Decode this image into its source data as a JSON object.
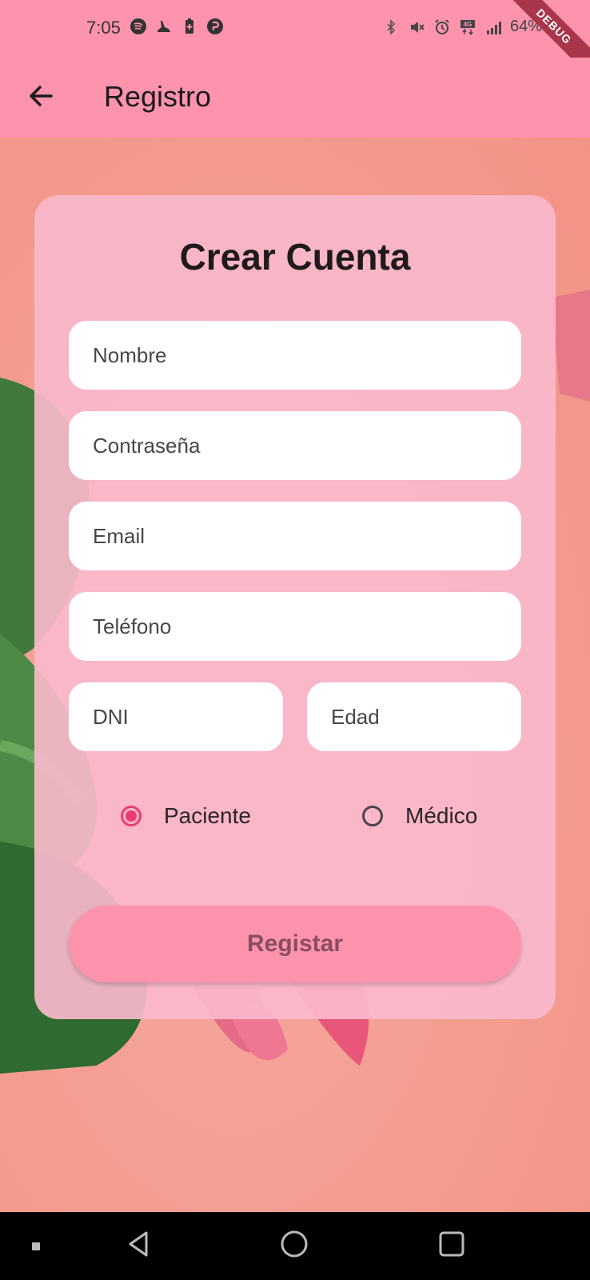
{
  "status_bar": {
    "time": "7:05",
    "battery": "64%",
    "debug_label": "DEBUG",
    "left_icons": [
      "spotify-icon",
      "shoe-icon",
      "battery-plus-icon",
      "p-app-icon"
    ],
    "right_icons": [
      "bluetooth-icon",
      "mute-icon",
      "alarm-icon",
      "4g-icon",
      "signal-icon",
      "battery-icon"
    ]
  },
  "app_bar": {
    "title": "Registro",
    "back_icon": "arrow-back-icon",
    "background": "#fd93ad"
  },
  "form": {
    "title": "Crear Cuenta",
    "fields": {
      "nombre": "Nombre",
      "password": "Contraseña",
      "email": "Email",
      "telefono": "Teléfono",
      "dni": "DNI",
      "edad": "Edad"
    },
    "roles": {
      "paciente": "Paciente",
      "medico": "Médico",
      "selected": "Paciente"
    },
    "submit_label": "Registar"
  },
  "colors": {
    "accent": "#e83e72",
    "card": "#f9b8cb",
    "background": "#f4a08f"
  }
}
